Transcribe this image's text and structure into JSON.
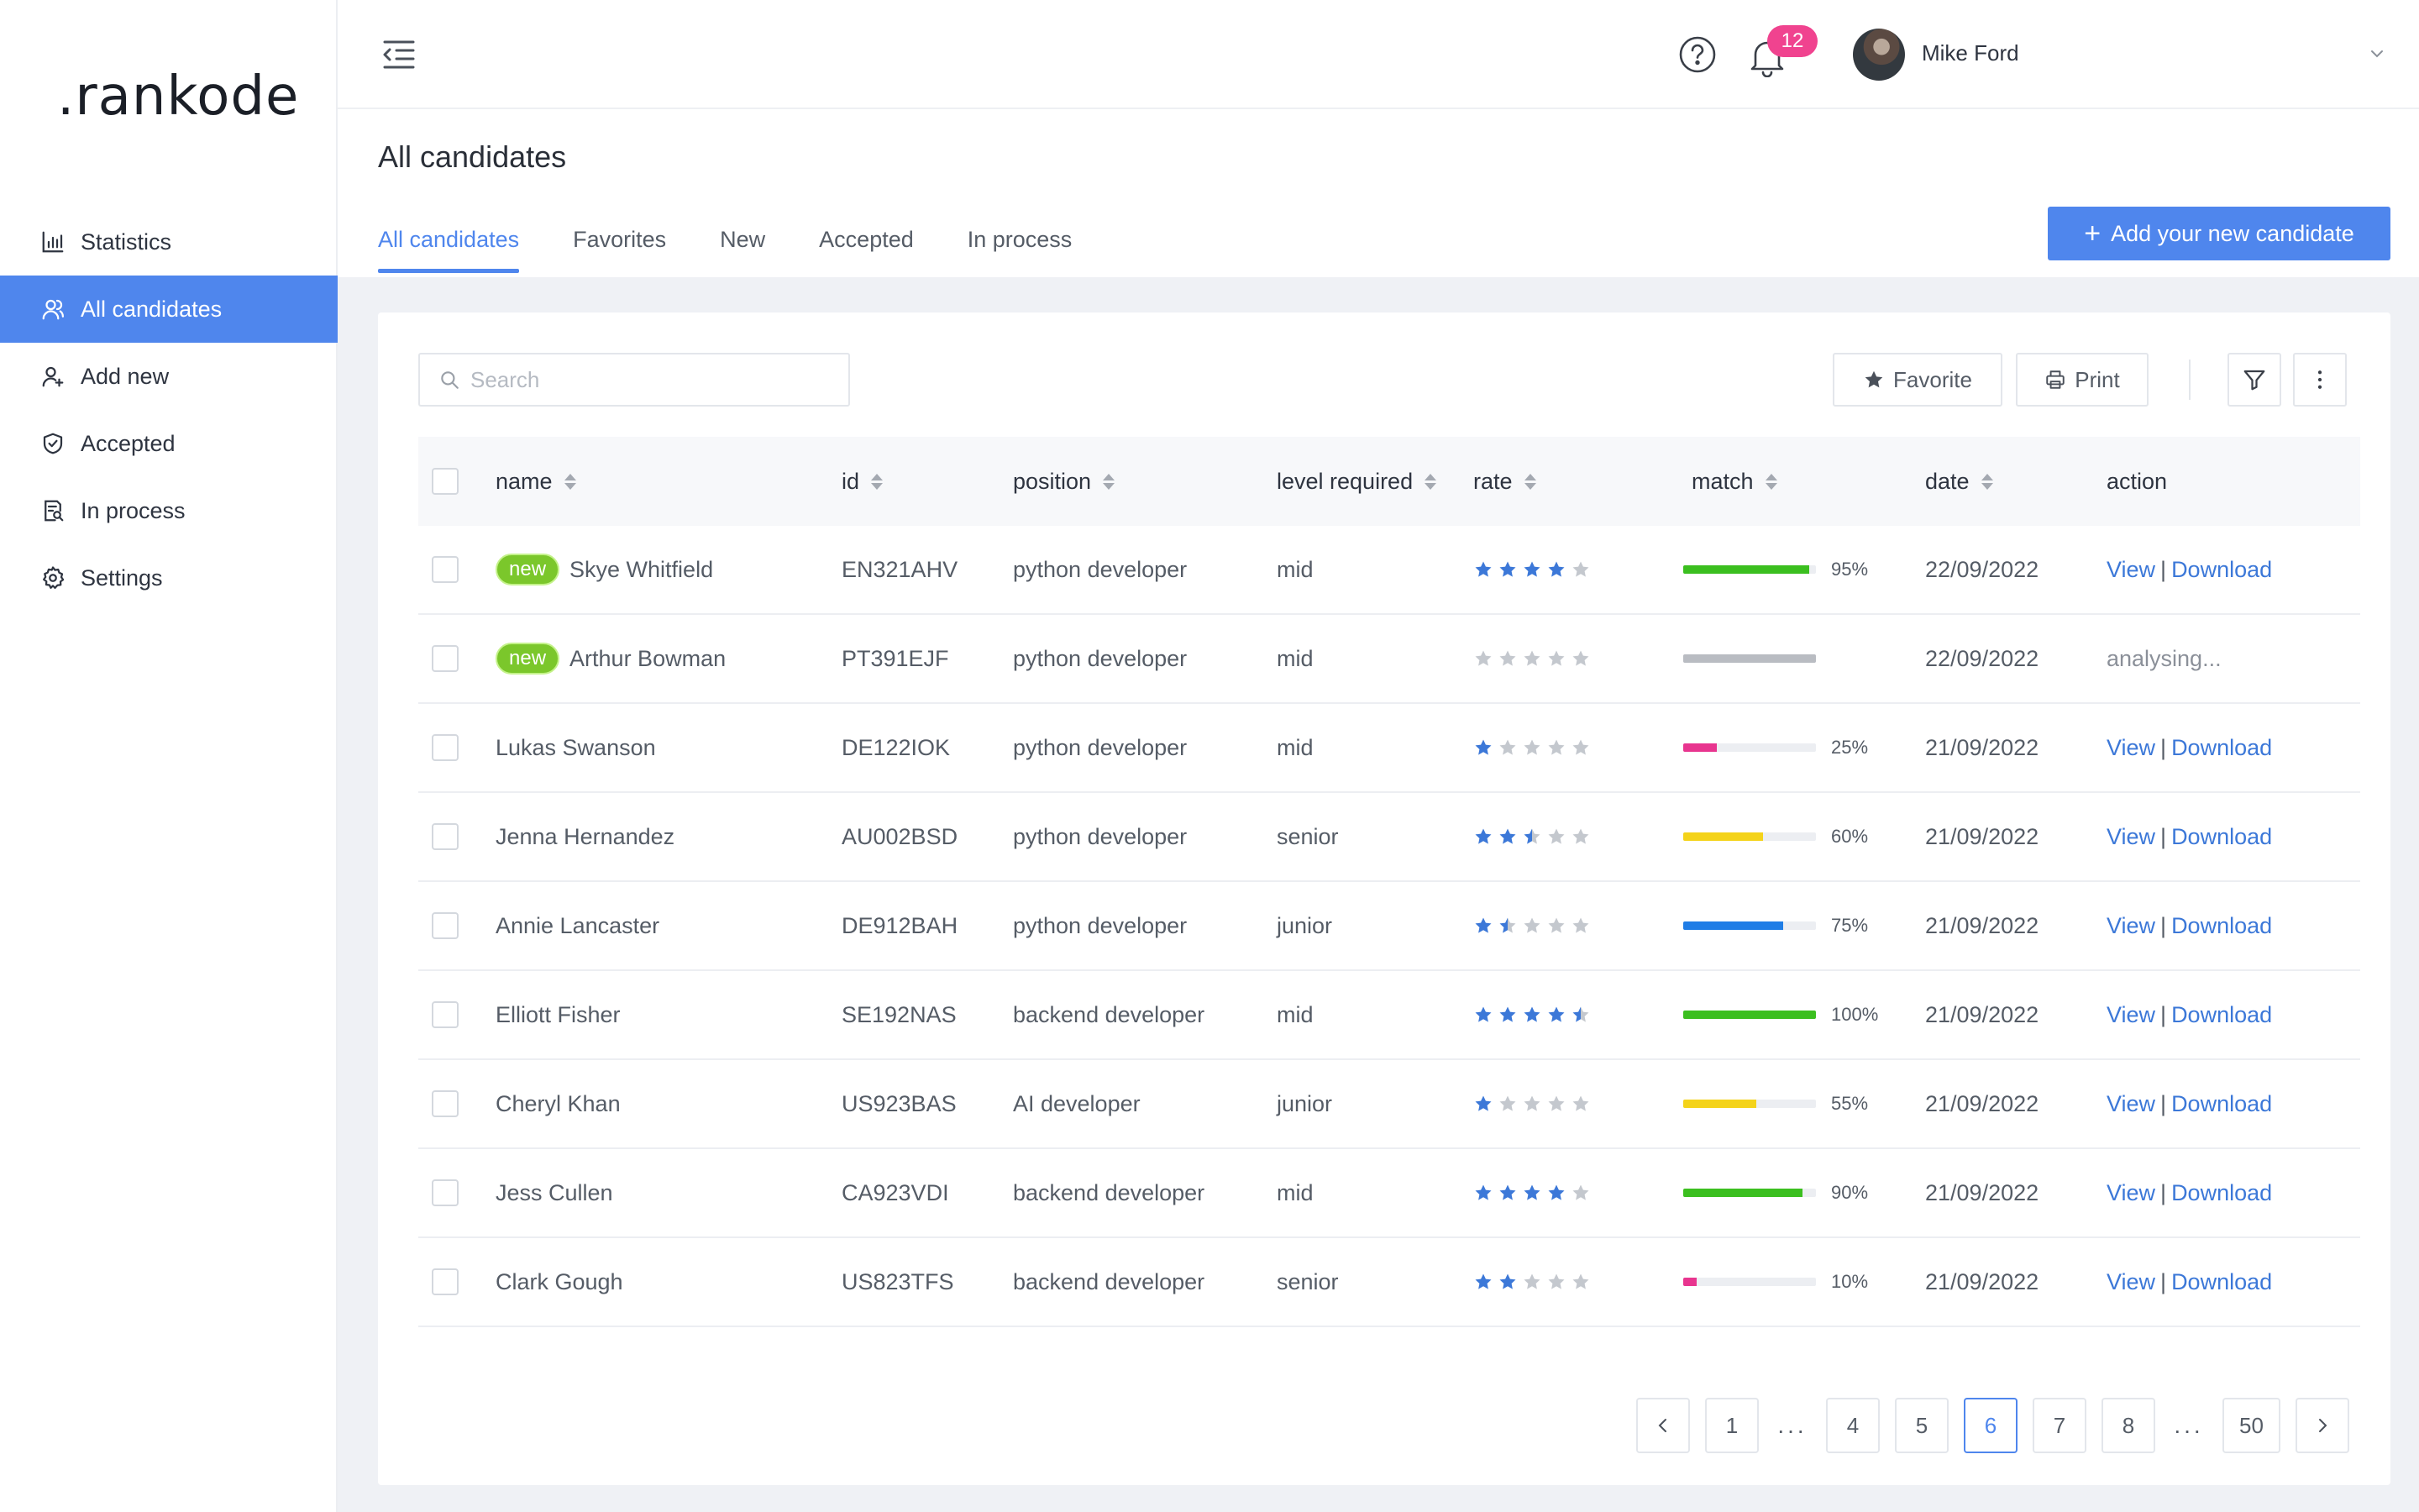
{
  "brand": {
    "logo": ".rankode"
  },
  "sidebar": {
    "items": [
      {
        "label": "Statistics",
        "icon": "bar-chart-icon",
        "active": false
      },
      {
        "label": "All candidates",
        "icon": "users-icon",
        "active": true
      },
      {
        "label": "Add new",
        "icon": "user-plus-icon",
        "active": false
      },
      {
        "label": "Accepted",
        "icon": "shield-check-icon",
        "active": false
      },
      {
        "label": "In process",
        "icon": "document-search-icon",
        "active": false
      },
      {
        "label": "Settings",
        "icon": "gear-icon",
        "active": false
      }
    ]
  },
  "header": {
    "notifications_count": "12",
    "user_name": "Mike Ford"
  },
  "page": {
    "title": "All candidates",
    "tabs": [
      {
        "label": "All candidates",
        "active": true
      },
      {
        "label": "Favorites",
        "active": false
      },
      {
        "label": "New",
        "active": false
      },
      {
        "label": "Accepted",
        "active": false
      },
      {
        "label": "In process",
        "active": false
      }
    ],
    "add_button": "Add your new candidate"
  },
  "toolbar": {
    "search_placeholder": "Search",
    "search_value": "",
    "favorite_label": "Favorite",
    "print_label": "Print"
  },
  "table": {
    "columns": [
      "name",
      "id",
      "position",
      "level required",
      "rate",
      "match",
      "date",
      "action"
    ],
    "new_tag": "new",
    "view_label": "View",
    "download_label": "Download",
    "separator": "|",
    "rows": [
      {
        "new": true,
        "name": "Skye Whitfield",
        "id": "EN321AHV",
        "position": "python developer",
        "level": "mid",
        "rate": 4,
        "match": 95,
        "match_label": "95%",
        "match_color": "#3bbf1f",
        "date": "22/09/2022",
        "status": ""
      },
      {
        "new": true,
        "name": "Arthur Bowman",
        "id": "PT391EJF",
        "position": "python developer",
        "level": "mid",
        "rate": 0,
        "match": 100,
        "match_label": "",
        "match_color": "#b9bcc2",
        "date": "22/09/2022",
        "status": "analysing..."
      },
      {
        "new": false,
        "name": "Lukas Swanson",
        "id": "DE122IOK",
        "position": "python developer",
        "level": "mid",
        "rate": 1,
        "match": 25,
        "match_label": "25%",
        "match_color": "#e8358f",
        "date": "21/09/2022",
        "status": ""
      },
      {
        "new": false,
        "name": "Jenna Hernandez",
        "id": "AU002BSD",
        "position": "python developer",
        "level": "senior",
        "rate": 2.5,
        "match": 60,
        "match_label": "60%",
        "match_color": "#f4d31a",
        "date": "21/09/2022",
        "status": ""
      },
      {
        "new": false,
        "name": "Annie Lancaster",
        "id": "DE912BAH",
        "position": "python developer",
        "level": "junior",
        "rate": 1.5,
        "match": 75,
        "match_label": "75%",
        "match_color": "#1f7de6",
        "date": "21/09/2022",
        "status": ""
      },
      {
        "new": false,
        "name": "Elliott Fisher",
        "id": "SE192NAS",
        "position": "backend developer",
        "level": "mid",
        "rate": 4.5,
        "match": 100,
        "match_label": "100%",
        "match_color": "#3bbf1f",
        "date": "21/09/2022",
        "status": ""
      },
      {
        "new": false,
        "name": "Cheryl Khan",
        "id": "US923BAS",
        "position": "AI developer",
        "level": "junior",
        "rate": 1,
        "match": 55,
        "match_label": "55%",
        "match_color": "#f4d31a",
        "date": "21/09/2022",
        "status": ""
      },
      {
        "new": false,
        "name": "Jess Cullen",
        "id": "CA923VDI",
        "position": "backend developer",
        "level": "mid",
        "rate": 4,
        "match": 90,
        "match_label": "90%",
        "match_color": "#3bbf1f",
        "date": "21/09/2022",
        "status": ""
      },
      {
        "new": false,
        "name": "Clark Gough",
        "id": "US823TFS",
        "position": "backend developer",
        "level": "senior",
        "rate": 2,
        "match": 10,
        "match_label": "10%",
        "match_color": "#e8358f",
        "date": "21/09/2022",
        "status": ""
      }
    ]
  },
  "pagination": {
    "pages": [
      "1",
      "...",
      "4",
      "5",
      "6",
      "7",
      "8",
      "...",
      "50"
    ],
    "current": "6"
  },
  "colors": {
    "accent": "#4f86ed",
    "star_on": "#3c78d8",
    "star_off": "#c4c8ce",
    "badge": "#f0438f",
    "new_tag": "#7bc72b"
  }
}
